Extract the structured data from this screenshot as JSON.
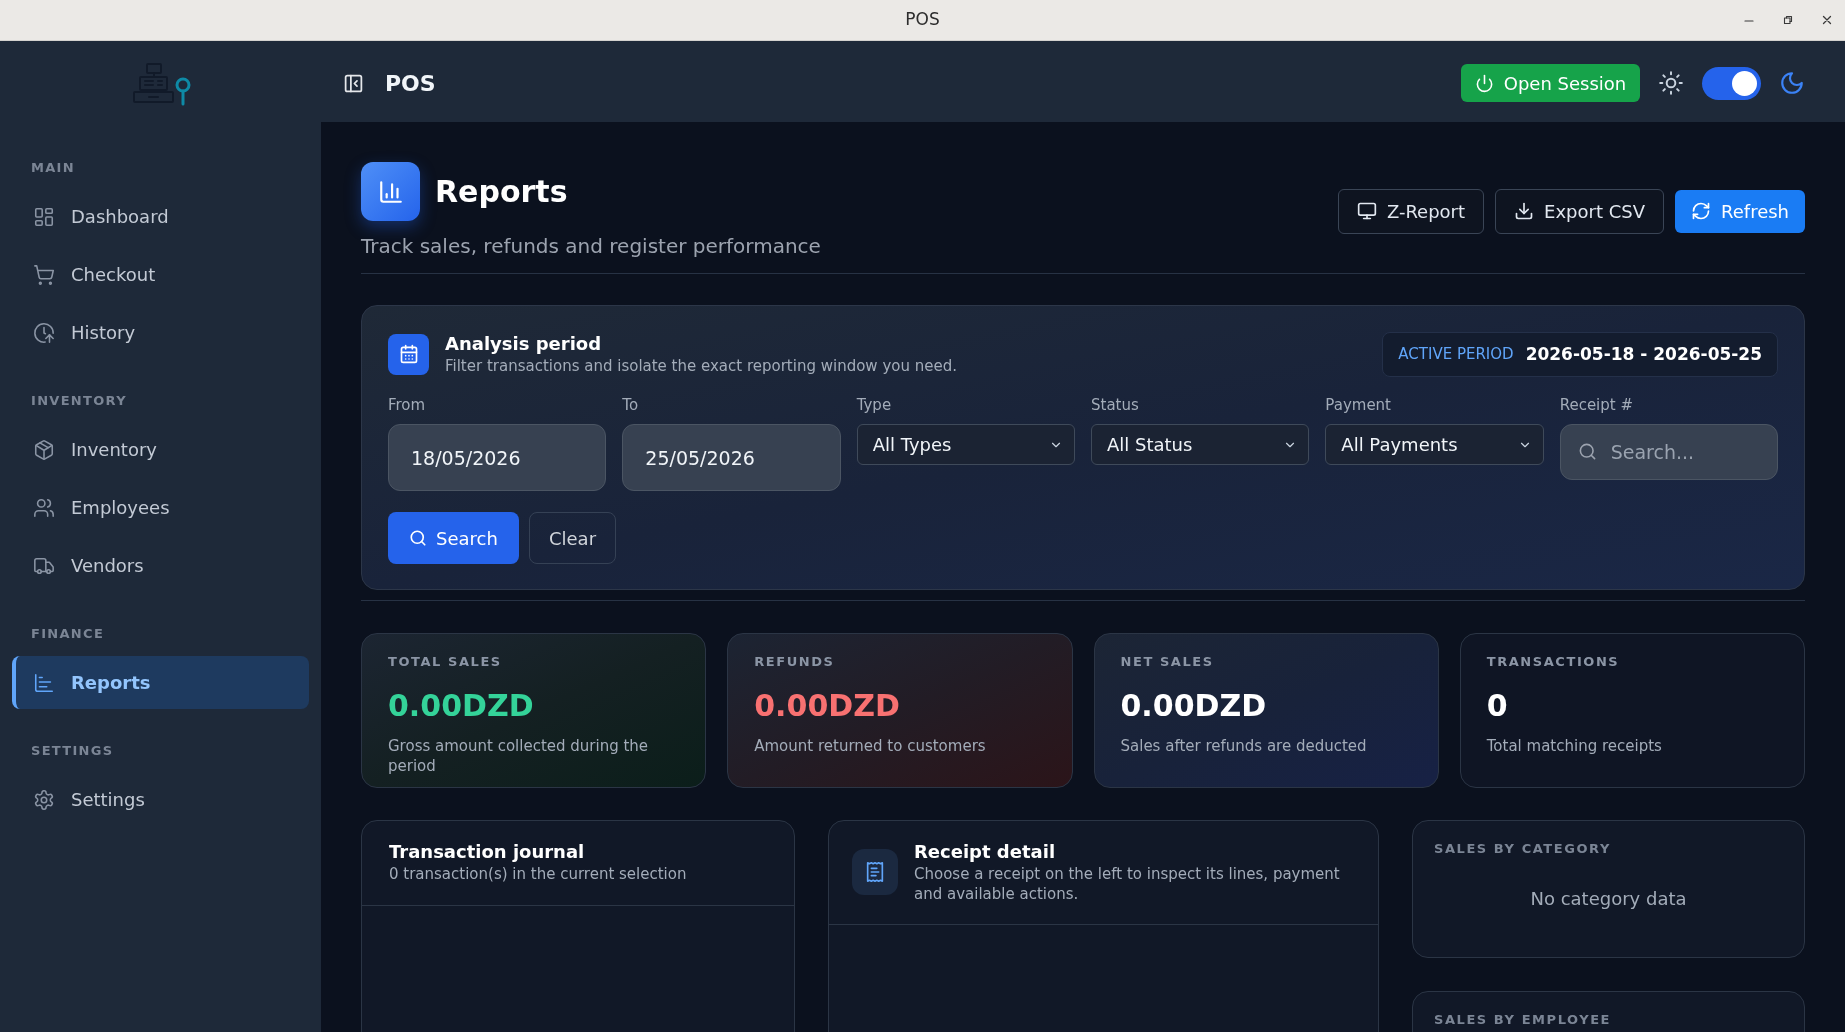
{
  "window": {
    "title": "POS"
  },
  "sidebar": {
    "sections": [
      {
        "label": "MAIN",
        "items": [
          {
            "label": "Dashboard",
            "selected": false
          },
          {
            "label": "Checkout",
            "selected": false
          },
          {
            "label": "History",
            "selected": false
          }
        ]
      },
      {
        "label": "INVENTORY",
        "items": [
          {
            "label": "Inventory",
            "selected": false
          },
          {
            "label": "Employees",
            "selected": false
          },
          {
            "label": "Vendors",
            "selected": false
          }
        ]
      },
      {
        "label": "FINANCE",
        "items": [
          {
            "label": "Reports",
            "selected": true
          }
        ]
      },
      {
        "label": "SETTINGS",
        "items": [
          {
            "label": "Settings",
            "selected": false
          }
        ]
      }
    ]
  },
  "top_bar": {
    "title": "POS",
    "session_button": "Open Session",
    "dark_mode_toggle": {
      "on": true
    }
  },
  "page_header": {
    "title": "Reports",
    "subtitle": "Track sales, refunds and register performance",
    "actions": [
      {
        "label": "Z-Report",
        "kind": "outline"
      },
      {
        "label": "Export CSV",
        "kind": "outline"
      },
      {
        "label": "Refresh",
        "kind": "primary"
      }
    ]
  },
  "analysis_period": {
    "title": "Analysis period",
    "subtitle": "Filter transactions and isolate the exact reporting window you need.",
    "active_period": {
      "label": "ACTIVE PERIOD",
      "value": "2026-05-18 - 2026-05-25"
    },
    "filters": [
      {
        "label": "From",
        "kind": "date",
        "value": "18/05/2026"
      },
      {
        "label": "To",
        "kind": "date",
        "value": "25/05/2026"
      },
      {
        "label": "Type",
        "kind": "select",
        "value": "All Types"
      },
      {
        "label": "Status",
        "kind": "select",
        "value": "All Status"
      },
      {
        "label": "Payment",
        "kind": "select",
        "value": "All Payments"
      },
      {
        "label": "Receipt #",
        "kind": "search",
        "placeholder": "Search..."
      }
    ],
    "buttons": [
      {
        "label": "Search",
        "kind": "primary"
      },
      {
        "label": "Clear",
        "kind": "outline"
      }
    ]
  },
  "stats": [
    {
      "label": "TOTAL SALES",
      "value": "0.00DZD",
      "description": "Gross amount collected during the period",
      "color": "#34d399",
      "kind": "sales"
    },
    {
      "label": "REFUNDS",
      "value": "0.00DZD",
      "description": "Amount returned to customers",
      "color": "#f87171",
      "kind": "refunds"
    },
    {
      "label": "NET SALES",
      "value": "0.00DZD",
      "description": "Sales after refunds are deducted",
      "color": "#ffffff",
      "kind": "net"
    },
    {
      "label": "TRANSACTIONS",
      "value": "0",
      "description": "Total matching receipts",
      "color": "#ffffff",
      "kind": "count"
    }
  ],
  "transaction_journal": {
    "title": "Transaction journal",
    "subtitle": "0 transaction(s) in the current selection"
  },
  "receipt_detail": {
    "title": "Receipt detail",
    "subtitle": "Choose a receipt on the left to inspect its lines, payment and available actions."
  },
  "sales_by_category": {
    "title": "SALES BY CATEGORY",
    "empty_message": "No category data"
  },
  "sales_by_employee": {
    "title": "SALES BY EMPLOYEE"
  }
}
